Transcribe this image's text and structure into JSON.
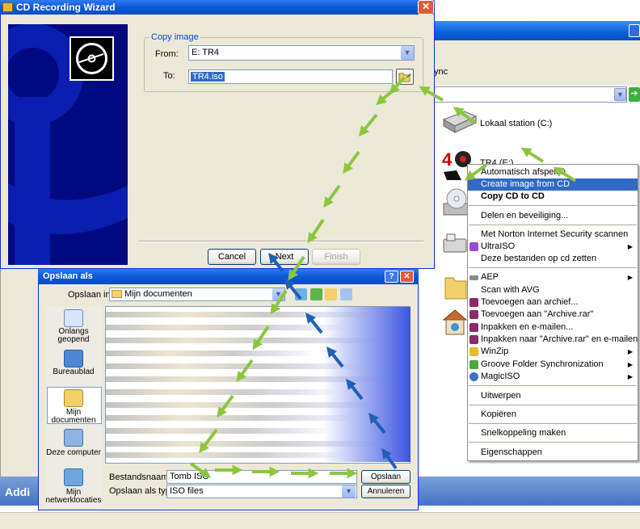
{
  "explorer": {
    "sync_label": "ync",
    "drives": [
      {
        "label": "Lokaal station (C:)"
      },
      {
        "label": "TR4 (E:)"
      }
    ],
    "additional_label": "Addi"
  },
  "wizard": {
    "title": "CD Recording Wizard",
    "group_label": "Copy image",
    "from_label": "From:",
    "from_value": "E: TR4",
    "to_label": "To:",
    "to_value": "TR4.iso",
    "buttons": {
      "cancel": "Cancel",
      "next": "Next",
      "finish": "Finish"
    }
  },
  "saveas": {
    "title": "Opslaan als",
    "lookin_label": "Opslaan in:",
    "lookin_value": "Mijn documenten",
    "places": [
      {
        "label": "Onlangs geopend"
      },
      {
        "label": "Bureaublad"
      },
      {
        "label": "Mijn documenten"
      },
      {
        "label": "Deze computer"
      },
      {
        "label": "Mijn netwerklocaties"
      }
    ],
    "filename_label": "Bestandsnaam:",
    "filename_value": "Tomb ISO",
    "filetype_label": "Opslaan als type:",
    "filetype_value": "ISO files",
    "save_button": "Opslaan",
    "cancel_button": "Annuleren"
  },
  "context_menu": {
    "items": [
      {
        "label": "Automatisch afspelen"
      },
      {
        "label": "Create image from CD"
      },
      {
        "label": "Copy CD to CD"
      },
      {
        "label": "Delen en beveiliging..."
      },
      {
        "label": "Met Norton Internet Security scannen"
      },
      {
        "label": "UltraISO"
      },
      {
        "label": "Deze bestanden op cd zetten"
      },
      {
        "label": "AEP"
      },
      {
        "label": "Scan with AVG"
      },
      {
        "label": "Toevoegen aan archief..."
      },
      {
        "label": "Toevoegen aan \"Archive.rar\""
      },
      {
        "label": "Inpakken en e-mailen..."
      },
      {
        "label": "Inpakken naar \"Archive.rar\" en e-mailen"
      },
      {
        "label": "WinZip"
      },
      {
        "label": "Groove Folder Synchronization"
      },
      {
        "label": "MagicISO"
      },
      {
        "label": "Uitwerpen"
      },
      {
        "label": "Kopiëren"
      },
      {
        "label": "Snelkoppeling maken"
      },
      {
        "label": "Eigenschappen"
      }
    ]
  },
  "colors": {
    "arrow_green": "#8cc63f",
    "arrow_blue": "#1f5fb8",
    "xp_title_blue": "#0b58d6",
    "menu_highlight": "#316ac5"
  }
}
